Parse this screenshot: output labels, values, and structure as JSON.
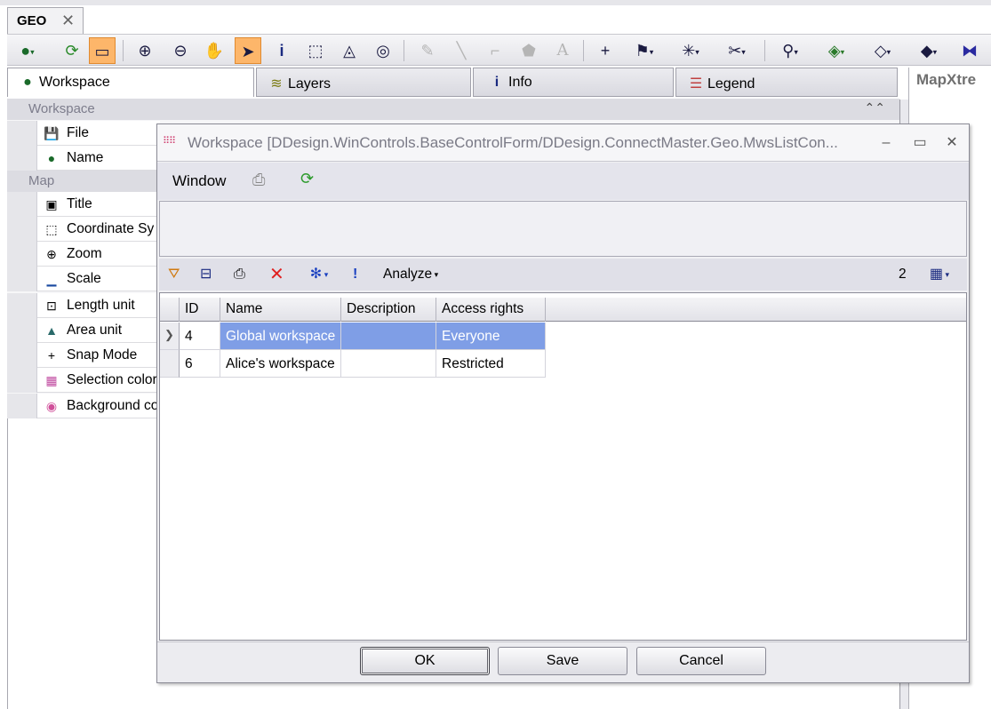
{
  "doc_tab": {
    "label": "GEO",
    "close": "✕"
  },
  "toolbar": {
    "icons": [
      "globe-icon",
      "refresh-icon",
      "map-view-icon",
      "zoom-in-icon",
      "zoom-out-icon",
      "pan-hand-icon",
      "select-arrow-icon",
      "info-icon",
      "rect-select-icon",
      "radius-select-icon",
      "target-select-icon",
      "edit-node-icon",
      "line-icon",
      "polyline-icon",
      "polygon-icon",
      "text-icon",
      "add-point-icon",
      "flag-icon",
      "star-select-icon",
      "tools-icon",
      "find-icon",
      "layer-control-icon",
      "layer-add-icon",
      "layer-edit-icon",
      "split-icon"
    ]
  },
  "panel_tabs": [
    {
      "label": "Workspace",
      "icon": "globe-icon"
    },
    {
      "label": "Layers",
      "icon": "layers-icon"
    },
    {
      "label": "Info",
      "icon": "info-icon"
    },
    {
      "label": "Legend",
      "icon": "legend-icon"
    }
  ],
  "right_strip": {
    "label": "MapXtre"
  },
  "tree": {
    "group_workspace": "Workspace",
    "workspace_items": [
      {
        "label": "File",
        "icon": "save-icon"
      },
      {
        "label": "Name",
        "icon": "globe-icon"
      }
    ],
    "group_map": "Map",
    "map_items": [
      {
        "label": "Title",
        "icon": "title-icon"
      },
      {
        "label": "Coordinate Sy",
        "icon": "coordinate-icon"
      },
      {
        "label": "Zoom",
        "icon": "zoom-icon"
      },
      {
        "label": "Scale",
        "icon": "scale-icon"
      },
      {
        "label": "Length unit",
        "icon": "length-icon"
      },
      {
        "label": "Area unit",
        "icon": "area-icon"
      },
      {
        "label": "Snap Mode",
        "icon": "snap-icon"
      },
      {
        "label": "Selection color",
        "icon": "palette-icon"
      },
      {
        "label": "Background co",
        "icon": "color-wheel-icon"
      }
    ]
  },
  "dialog": {
    "title": "Workspace [DDesign.WinControls.BaseControlForm/DDesign.ConnectMaster.Geo.MwsListCon...",
    "menu_window": "Window",
    "analyze_label": "Analyze",
    "record_count": "2",
    "columns": [
      "ID",
      "Name",
      "Description",
      "Access rights"
    ],
    "rows": [
      {
        "id": "4",
        "name": "Global workspace",
        "description": "",
        "access": "Everyone",
        "selected": true
      },
      {
        "id": "6",
        "name": "Alice's workspace",
        "description": "",
        "access": "Restricted",
        "selected": false
      }
    ],
    "buttons": {
      "ok": "OK",
      "save": "Save",
      "cancel": "Cancel"
    }
  }
}
